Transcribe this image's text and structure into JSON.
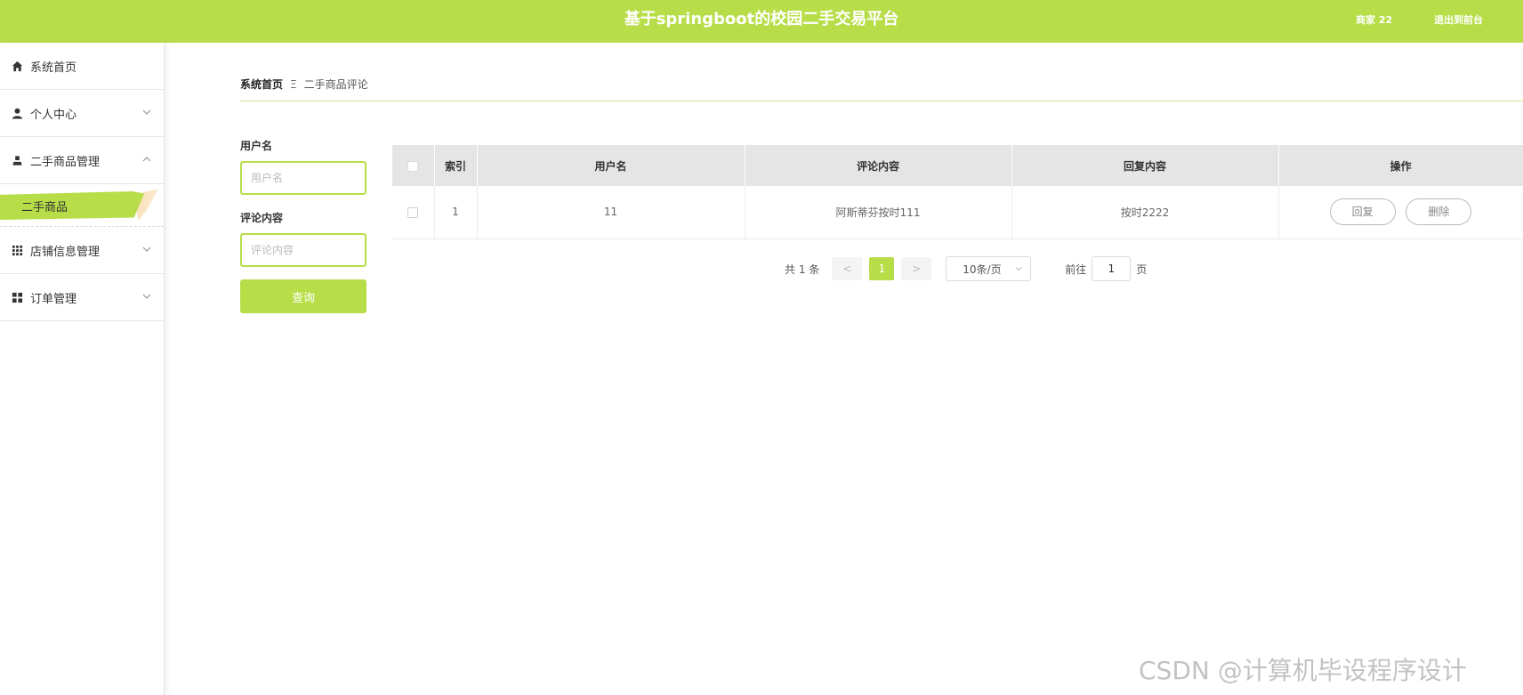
{
  "header": {
    "title": "基于springboot的校园二手交易平台",
    "user": "商家 22",
    "logout": "退出到前台"
  },
  "sidebar": {
    "items": [
      {
        "label": "系统首页",
        "icon": "home-icon"
      },
      {
        "label": "个人中心",
        "icon": "user-icon"
      },
      {
        "label": "二手商品管理",
        "icon": "user-small-icon"
      },
      {
        "label": "店铺信息管理",
        "icon": "grid-icon"
      },
      {
        "label": "订单管理",
        "icon": "squares-icon"
      }
    ],
    "submenu_active": "二手商品"
  },
  "breadcrumb": {
    "home": "系统首页",
    "separator": "Ξ",
    "current": "二手商品评论"
  },
  "search": {
    "username_label": "用户名",
    "username_placeholder": "用户名",
    "comment_label": "评论内容",
    "comment_placeholder": "评论内容",
    "button": "查询"
  },
  "table": {
    "headers": [
      "索引",
      "用户名",
      "评论内容",
      "回复内容",
      "操作"
    ],
    "rows": [
      {
        "index": "1",
        "username": "11",
        "comment": "阿斯蒂芬按时111",
        "reply": "按时2222"
      }
    ],
    "reply_button": "回复",
    "delete_button": "删除"
  },
  "pagination": {
    "total": "共 1 条",
    "prev": "<",
    "current": "1",
    "next": ">",
    "page_size": "10条/页",
    "goto_label": "前往",
    "goto_value": "1",
    "page_suffix": "页"
  },
  "watermark": "CSDN @计算机毕设程序设计",
  "colors": {
    "accent": "#b7dd48"
  }
}
